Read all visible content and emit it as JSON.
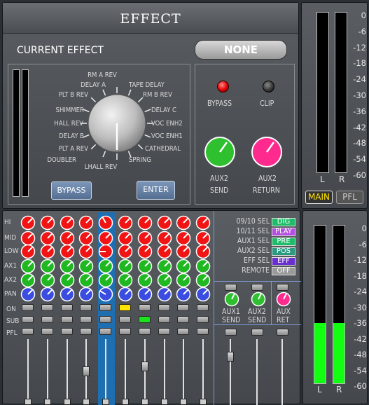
{
  "effect_panel": {
    "title": "EFFECT",
    "current_effect_label": "CURRENT EFFECT",
    "current_effect_value": "NONE",
    "effects": [
      "RM A REV",
      "TAPE DELAY",
      "RM B REV",
      "DELAY C",
      "VOC ENH2",
      "VOC ENH1",
      "CATHEDRAL",
      "SPRING",
      "LHALL REV",
      "DOUBLER",
      "PLT A REV",
      "DELAY B",
      "HALL REV",
      "SHIMMER",
      "PLT B REV",
      "DELAY A"
    ],
    "bypass_button": "BYPASS",
    "enter_button": "ENTER",
    "bypass_led_label": "BYPASS",
    "clip_led_label": "CLIP",
    "aux2_send_label": [
      "AUX2",
      "SEND"
    ],
    "aux2_return_label": [
      "AUX2",
      "RETURN"
    ]
  },
  "main_meter": {
    "scale": [
      "0",
      "-6",
      "-12",
      "-18",
      "-24",
      "-30",
      "-36",
      "-42",
      "-48",
      "-54",
      "-60"
    ],
    "left_label": "L",
    "right_label": "R",
    "main_button": "MAIN",
    "pfl_button": "PFL",
    "level_fraction": 0
  },
  "pfl_meter": {
    "scale": [
      "0",
      "-6",
      "-12",
      "-18",
      "-24",
      "-30",
      "-36",
      "-42",
      "-48",
      "-54",
      "-60"
    ],
    "left_label": "L",
    "right_label": "R",
    "level_fraction": 0.38
  },
  "mixer": {
    "row_labels": [
      "HI",
      "MID",
      "LOW",
      "AX1",
      "AX2",
      "PAN"
    ],
    "button_labels": [
      "ON",
      "SUB",
      "PFL"
    ],
    "select_rows": [
      {
        "label": "09/10 SEL",
        "value": "DIG",
        "color": "#1fbd6a"
      },
      {
        "label": "10/11 SEL",
        "value": "PLAY",
        "color": "#b44de0"
      },
      {
        "label": "AUX1 SEL",
        "value": "PRE",
        "color": "#1fbd6a"
      },
      {
        "label": "AUX2 SEL",
        "value": "POS",
        "color": "#2a9a80"
      },
      {
        "label": "EFF SEL",
        "value": "EFF",
        "color": "#6b2fd0"
      },
      {
        "label": "REMOTE",
        "value": "OFF",
        "color": "#9a9a9a"
      }
    ],
    "aux1_send": [
      "AUX1",
      "SEND"
    ],
    "aux2_send": [
      "AUX2",
      "SEND"
    ],
    "aux_ret": [
      "AUX",
      "RET"
    ]
  }
}
